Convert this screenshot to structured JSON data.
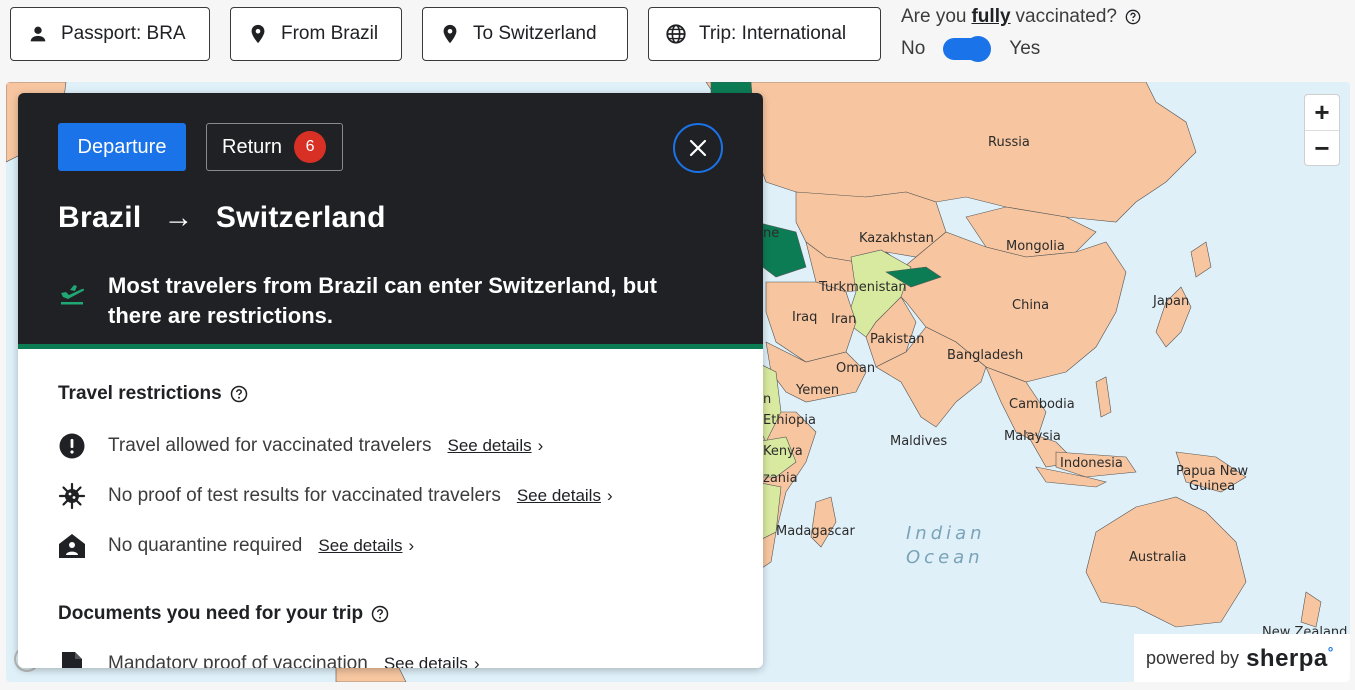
{
  "filters": {
    "passport": "Passport: BRA",
    "from": "From Brazil",
    "to": "To Switzerland",
    "trip": "Trip: International"
  },
  "vaccination": {
    "question_prefix": "Are you",
    "question_emph": "fully",
    "question_suffix": "vaccinated?",
    "no_label": "No",
    "yes_label": "Yes",
    "toggle_on": true
  },
  "panel": {
    "departure_tab": "Departure",
    "return_tab": "Return",
    "return_badge": "6",
    "origin": "Brazil",
    "arrow": "→",
    "destination": "Switzerland",
    "summary": "Most travelers from Brazil can enter Switzerland, but there are restrictions.",
    "restrictions_title": "Travel restrictions",
    "restrictions": [
      {
        "icon": "exclamation-icon",
        "text": "Travel allowed for vaccinated travelers",
        "link": "See details"
      },
      {
        "icon": "virus-icon",
        "text": "No proof of test results for vaccinated travelers",
        "link": "See details"
      },
      {
        "icon": "house-person-icon",
        "text": "No quarantine required",
        "link": "See details"
      }
    ],
    "documents_title": "Documents you need for your trip",
    "documents": [
      {
        "icon": "document-icon",
        "text": "Mandatory proof of vaccination",
        "link": "See details"
      }
    ]
  },
  "map": {
    "labels": {
      "russia": "Russia",
      "kazakhstan": "Kazakhstan",
      "mongolia": "Mongolia",
      "turkmenistan": "Turkmenistan",
      "china": "China",
      "japan": "Japan",
      "iraq": "Iraq",
      "iran": "Iran",
      "pakistan": "Pakistan",
      "bangladesh": "Bangladesh",
      "oman": "Oman",
      "yemen": "Yemen",
      "cambodia": "Cambodia",
      "ethiopia": "Ethiopia",
      "maldives": "Maldives",
      "malaysia": "Malaysia",
      "kenya": "Kenya",
      "indonesia": "Indonesia",
      "papua_line1": "Papua New",
      "papua_line2": "Guinea",
      "tanzania": "zania",
      "madagascar": "Madagascar",
      "indian_line1": "Indian",
      "indian_line2": "Ocean",
      "australia": "Australia",
      "new_zealand": "New Zealand",
      "partial_me": "ne",
      "partial_n": "n"
    },
    "zoom_in": "+",
    "zoom_out": "−"
  },
  "branding": {
    "powered_by": "powered by",
    "brand": "sherpa",
    "brand_mark": "°"
  },
  "colors": {
    "accent": "#1a73e8",
    "panel_dark": "#202124",
    "status_green": "#0c7c55",
    "badge_red": "#d93025",
    "land": "#f7c6a0",
    "ocean": "#dff0f9"
  }
}
